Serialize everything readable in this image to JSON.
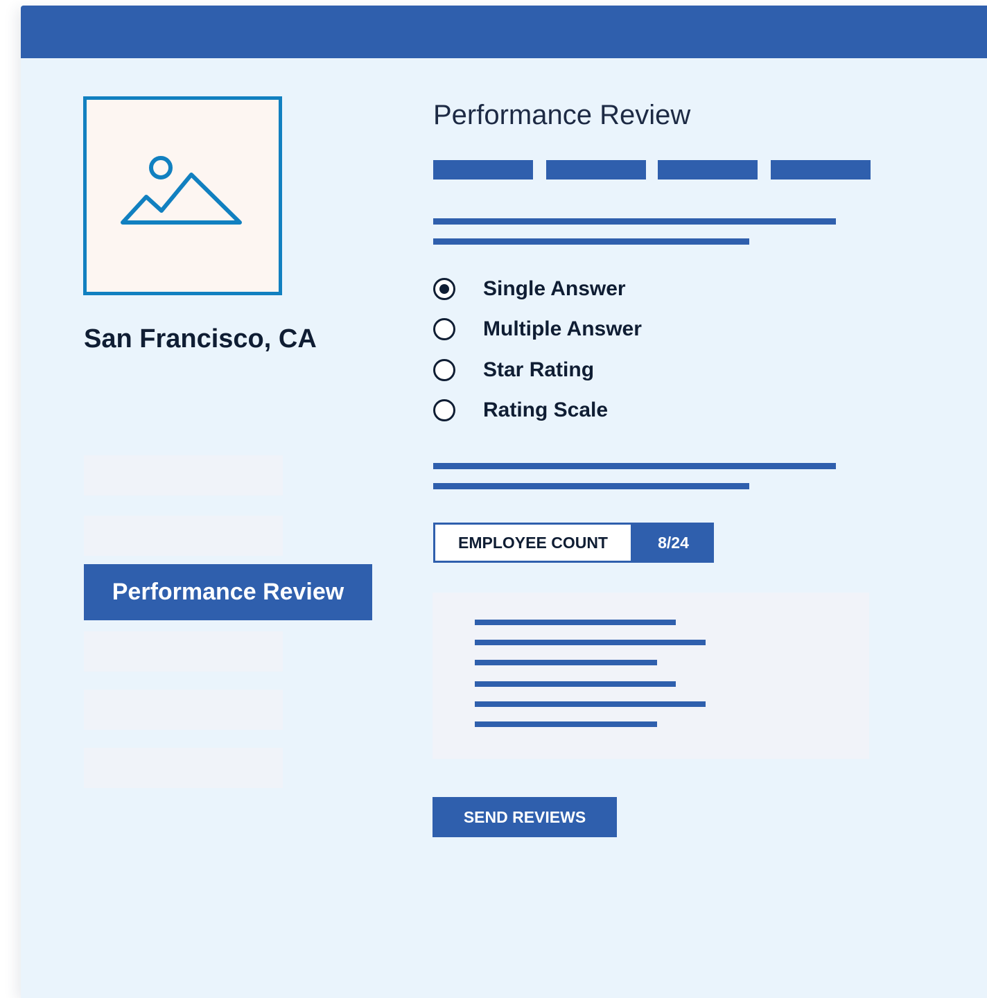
{
  "sidebar": {
    "location": "San Francisco, CA",
    "active_item_label": "Performance Review"
  },
  "main": {
    "title": "Performance Review",
    "question_types": [
      {
        "label": "Single Answer",
        "selected": true
      },
      {
        "label": "Multiple Answer",
        "selected": false
      },
      {
        "label": "Star Rating",
        "selected": false
      },
      {
        "label": "Rating Scale",
        "selected": false
      }
    ],
    "employee_count": {
      "label": "EMPLOYEE COUNT",
      "value": "8/24"
    },
    "send_button_label": "SEND REVIEWS"
  },
  "colors": {
    "primary": "#2f5fad",
    "accent": "#1180c0",
    "text_dark": "#0f1d33",
    "background": "#eaf4fc"
  },
  "icons": {
    "image_placeholder": "image-icon"
  }
}
